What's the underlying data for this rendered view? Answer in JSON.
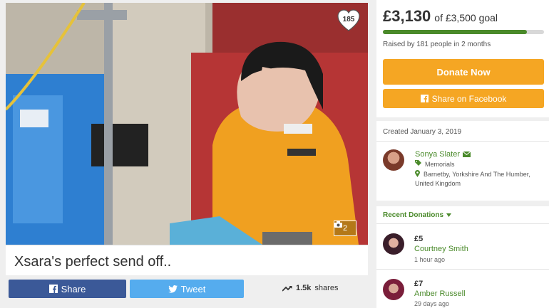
{
  "campaign": {
    "title": "Xsara's perfect send off..",
    "likes": "185",
    "photo_count": "2"
  },
  "share_bar": {
    "facebook_label": "Share",
    "tweet_label": "Tweet",
    "shares_count": "1.5k",
    "shares_label": "shares"
  },
  "funding": {
    "raised": "£3,130",
    "goal_text": "of £3,500 goal",
    "progress": 0.894,
    "raised_by": "Raised by 181 people in 2 months",
    "donate_label": "Donate Now",
    "share_fb_label": "Share on Facebook"
  },
  "organizer": {
    "created": "Created January 3, 2019",
    "name": "Sonya Slater",
    "category": "Memorials",
    "location_line1": "Barnetby, Yorkshire And The Humber,",
    "location_line2": "United Kingdom"
  },
  "donations": {
    "header": "Recent Donations",
    "items": [
      {
        "amount": "£5",
        "name": "Courtney Smith",
        "time": "1 hour ago"
      },
      {
        "amount": "£7",
        "name": "Amber Russell",
        "time": "29 days ago"
      }
    ]
  },
  "colors": {
    "accent_green": "#4a8a2a",
    "donate_orange": "#f5a623",
    "facebook_blue": "#3b5998",
    "twitter_blue": "#55acee"
  }
}
